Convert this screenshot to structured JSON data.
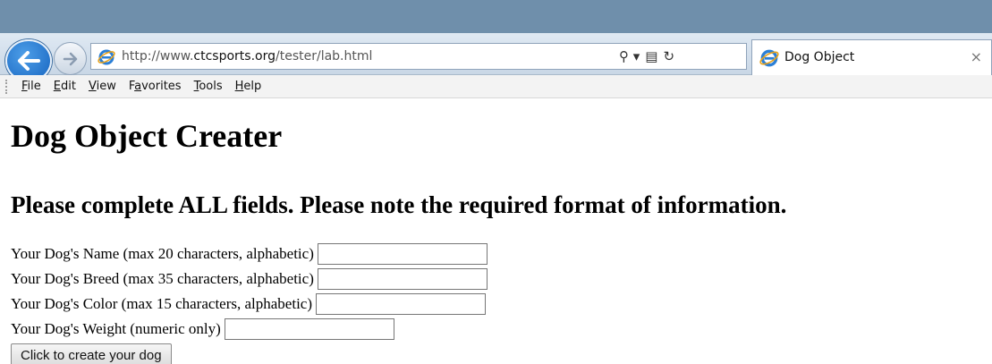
{
  "browser": {
    "url_prefix": "http://www.",
    "url_domain": "ctcsports.org",
    "url_path": "/tester/lab.html",
    "tools": {
      "search_glyph": "⚲ ▾",
      "compat_glyph": "▤",
      "refresh_glyph": "↻"
    },
    "tab": {
      "title": "Dog Object",
      "close_glyph": "×"
    },
    "menu": [
      {
        "pre": "",
        "key": "F",
        "post": "ile"
      },
      {
        "pre": "",
        "key": "E",
        "post": "dit"
      },
      {
        "pre": "",
        "key": "V",
        "post": "iew"
      },
      {
        "pre": "F",
        "key": "a",
        "post": "vorites"
      },
      {
        "pre": "",
        "key": "T",
        "post": "ools"
      },
      {
        "pre": "",
        "key": "H",
        "post": "elp"
      }
    ],
    "colors": {
      "accent": "#1765c0",
      "titlebar": "#6f8fab"
    }
  },
  "page": {
    "title": "Dog Object Creater",
    "instructions": "Please complete ALL fields. Please note the required format of information.",
    "fields": [
      {
        "label": "Your Dog's Name (max 20 characters, alphabetic)",
        "value": ""
      },
      {
        "label": "Your Dog's Breed (max 35 characters, alphabetic)",
        "value": ""
      },
      {
        "label": "Your Dog's Color (max 15 characters, alphabetic)",
        "value": ""
      },
      {
        "label": "Your Dog's Weight (numeric only)",
        "value": ""
      }
    ],
    "submit_label": "Click to create your dog"
  }
}
